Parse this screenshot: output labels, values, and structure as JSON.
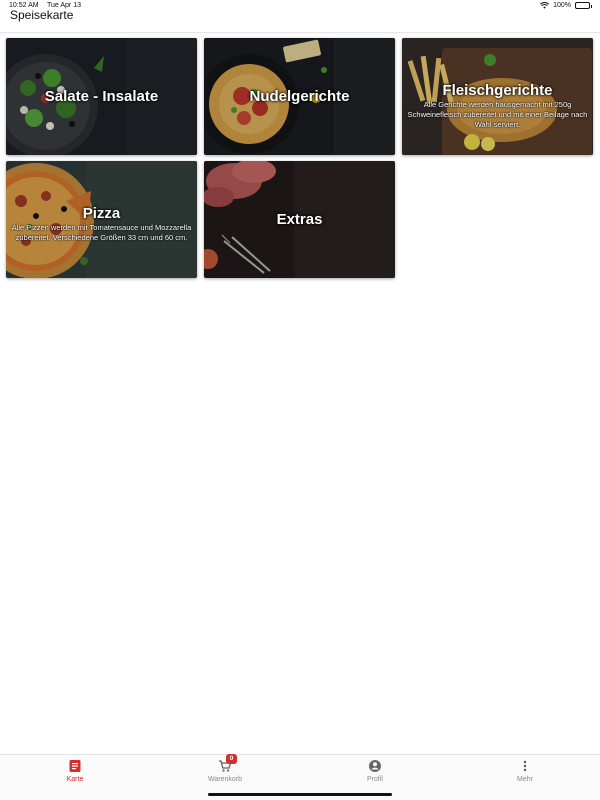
{
  "status_bar": {
    "time": "10:52 AM",
    "date": "Tue Apr 13",
    "battery": "100%"
  },
  "header": {
    "title": "Speisekarte"
  },
  "categories": [
    {
      "title": "Salate - Insalate",
      "description": ""
    },
    {
      "title": "Nudelgerichte",
      "description": ""
    },
    {
      "title": "Fleischgerichte",
      "description": "Alle Gerichte werden hausgemacht mit 250g Schweinefleisch zubereitet und mit einer Beilage nach Wahl serviert."
    },
    {
      "title": "Pizza",
      "description": "Alle Pizzen werden mit Tomatensauce und Mozzarella zubereitet. Verschiedene Größen 33 cm und 60 cm."
    },
    {
      "title": "Extras",
      "description": ""
    }
  ],
  "tabs": [
    {
      "label": "Karte",
      "icon": "menu-icon",
      "active": true
    },
    {
      "label": "Warenkorb",
      "icon": "cart-icon",
      "badge": "0"
    },
    {
      "label": "Profil",
      "icon": "profile-icon"
    },
    {
      "label": "Mehr",
      "icon": "more-icon"
    }
  ],
  "colors": {
    "accent": "#d32f2f",
    "inactive": "#8a8a8a"
  }
}
